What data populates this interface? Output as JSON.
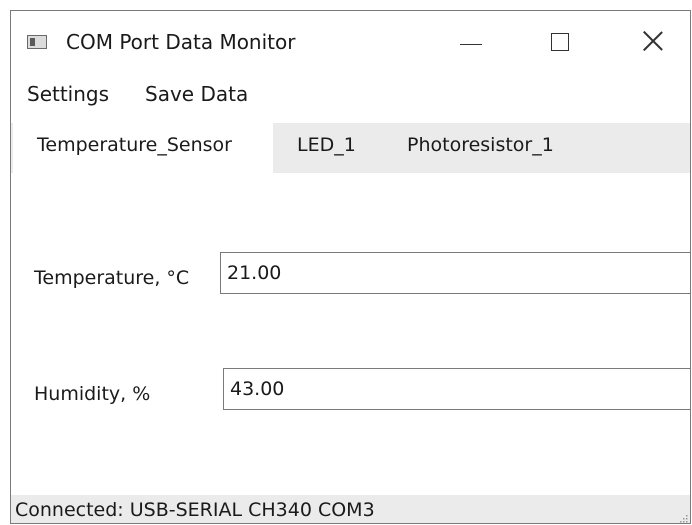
{
  "window": {
    "title": "COM Port Data Monitor",
    "icon": "app-window-icon",
    "controls": {
      "minimize": "minimize-icon",
      "maximize": "maximize-icon",
      "close": "close-icon"
    }
  },
  "menu": {
    "items": [
      {
        "label": "Settings"
      },
      {
        "label": "Save Data"
      }
    ]
  },
  "tabs": [
    {
      "label": "Temperature_Sensor",
      "selected": true
    },
    {
      "label": "LED_1",
      "selected": false
    },
    {
      "label": "Photoresistor_1",
      "selected": false
    }
  ],
  "fields": {
    "temperature": {
      "label": "Temperature, °C",
      "value": "21.00"
    },
    "humidity": {
      "label": "Humidity, %",
      "value": "43.00"
    }
  },
  "status": {
    "text": "Connected: USB-SERIAL CH340 COM3"
  },
  "colors": {
    "tab_strip_bg": "#ebebeb",
    "status_bar_bg": "#ebebeb",
    "input_border": "#7a7a7a"
  }
}
